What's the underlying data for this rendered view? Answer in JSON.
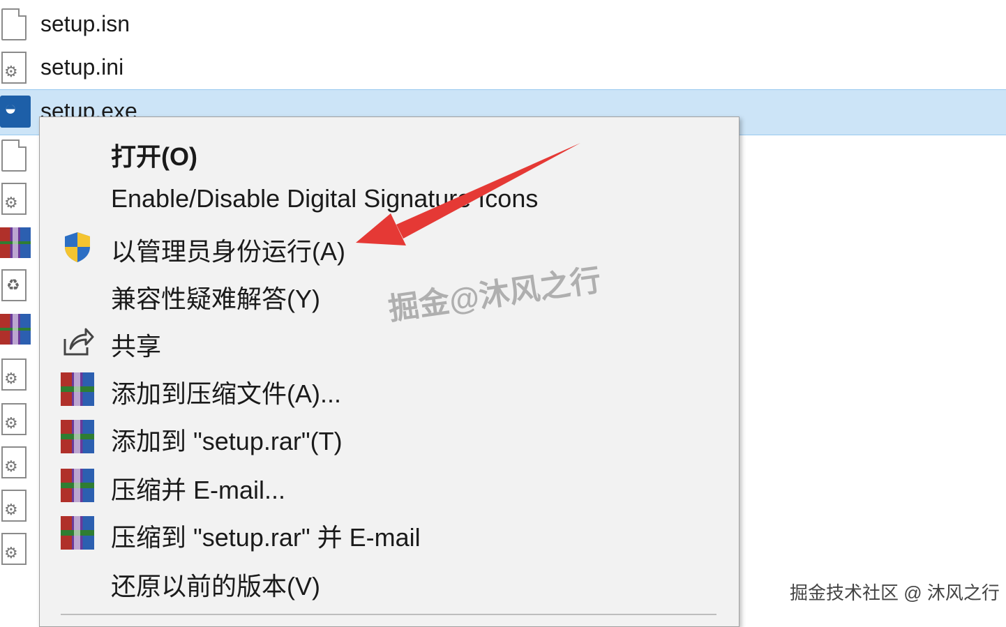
{
  "files": [
    {
      "name": "setup.isn",
      "icon": "blank-file-icon"
    },
    {
      "name": "setup.ini",
      "icon": "settings-file-icon"
    },
    {
      "name": "setup.exe",
      "icon": "installer-icon",
      "selected": true
    }
  ],
  "context_menu": {
    "items": [
      {
        "label": "打开(O)",
        "icon": null
      },
      {
        "label": "Enable/Disable Digital Signature Icons",
        "icon": null
      },
      {
        "label": "以管理员身份运行(A)",
        "icon": "uac-shield-icon"
      },
      {
        "label": "兼容性疑难解答(Y)",
        "icon": null
      },
      {
        "label": "共享",
        "icon": "share-icon"
      },
      {
        "label": "添加到压缩文件(A)...",
        "icon": "winrar-icon"
      },
      {
        "label": "添加到 \"setup.rar\"(T)",
        "icon": "winrar-icon"
      },
      {
        "label": "压缩并 E-mail...",
        "icon": "winrar-icon"
      },
      {
        "label": "压缩到 \"setup.rar\" 并 E-mail",
        "icon": "winrar-icon"
      },
      {
        "label": "还原以前的版本(V)",
        "icon": null
      }
    ]
  },
  "watermarks": {
    "center": "掘金@沐风之行",
    "corner": "掘金技术社区 @ 沐风之行"
  },
  "colors": {
    "selection": "#cce4f7",
    "menu_bg": "#f2f2f2",
    "arrow": "#e53935"
  }
}
